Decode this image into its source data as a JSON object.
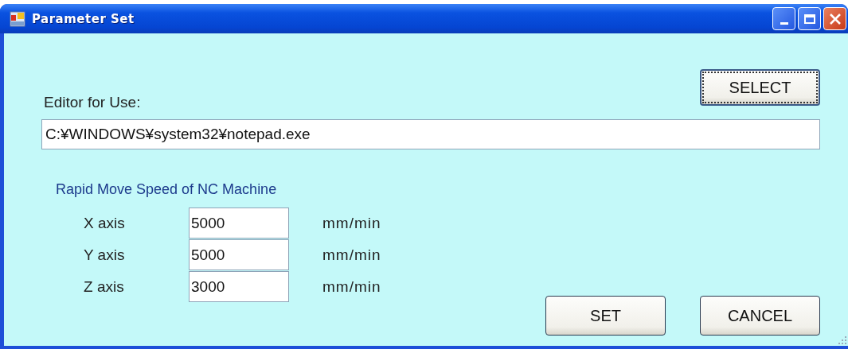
{
  "window": {
    "title": "Parameter Set"
  },
  "editor": {
    "label": "Editor for Use:",
    "value": "C:¥WINDOWS¥system32¥notepad.exe",
    "select_button": {
      "label": "SELECT",
      "focused": true
    }
  },
  "speed_group": {
    "title": "Rapid Move Speed of NC Machine",
    "axes": [
      {
        "label": "X axis",
        "value": "5000",
        "unit": "mm/min"
      },
      {
        "label": "Y axis",
        "value": "5000",
        "unit": "mm/min"
      },
      {
        "label": "Z axis",
        "value": "3000",
        "unit": "mm/min"
      }
    ]
  },
  "buttons": [
    {
      "label": "SET",
      "focused": false
    },
    {
      "label": "CANCEL",
      "focused": false
    }
  ]
}
